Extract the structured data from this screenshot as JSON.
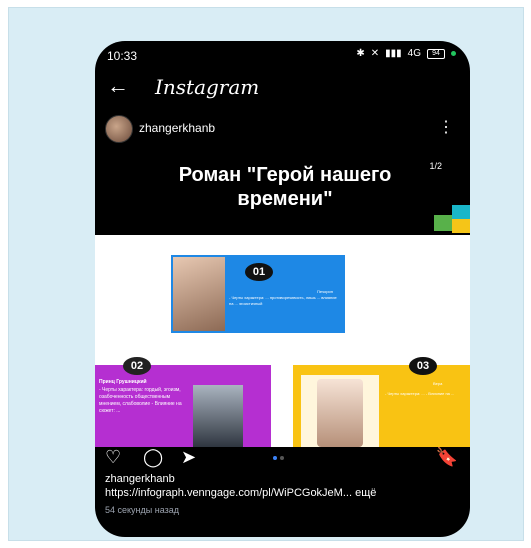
{
  "status_bar": {
    "time": "10:33",
    "icons": [
      "bluetooth-icon",
      "mute-icon",
      "signal-icon",
      "4g-signal-icon",
      "battery-icon",
      "notification-dot"
    ],
    "battery_label": "94",
    "signal_text": "4G"
  },
  "topbar": {
    "back": "←",
    "logo": "Instagram"
  },
  "user": {
    "name": "zhangerkhanb",
    "more": "⋮"
  },
  "post": {
    "title": "Роман \"Герой нашего времени\"",
    "page_indicator": "1/2",
    "cards": [
      {
        "number": "01",
        "label": "Печорин",
        "text": "- Черты характера: ... противоречивость, лишь ... влияние на ... эгоистичный"
      },
      {
        "number": "02",
        "label": "Принц Грушницкий",
        "text": "- Черты характера: гордый, эгоизм, озабоченность общественным мнением, слабоволие - Влияние на сюжет: ..."
      },
      {
        "number": "03",
        "label": "Вера",
        "text": "- Черты характера: ... - Влияние на ..."
      }
    ],
    "accent_colors": {
      "blue": "#1e88e5",
      "purple": "#b52fd1",
      "yellow": "#f9c313"
    }
  },
  "actions": {
    "like": "♡",
    "comment": "◯",
    "share": "➤",
    "save": "🔖"
  },
  "caption": {
    "username": "zhangerkhanb",
    "link": "https://infograph.venngage.com/pl/WiPCGokJeM...",
    "more": "ещё",
    "time": "54 секунды назад"
  }
}
